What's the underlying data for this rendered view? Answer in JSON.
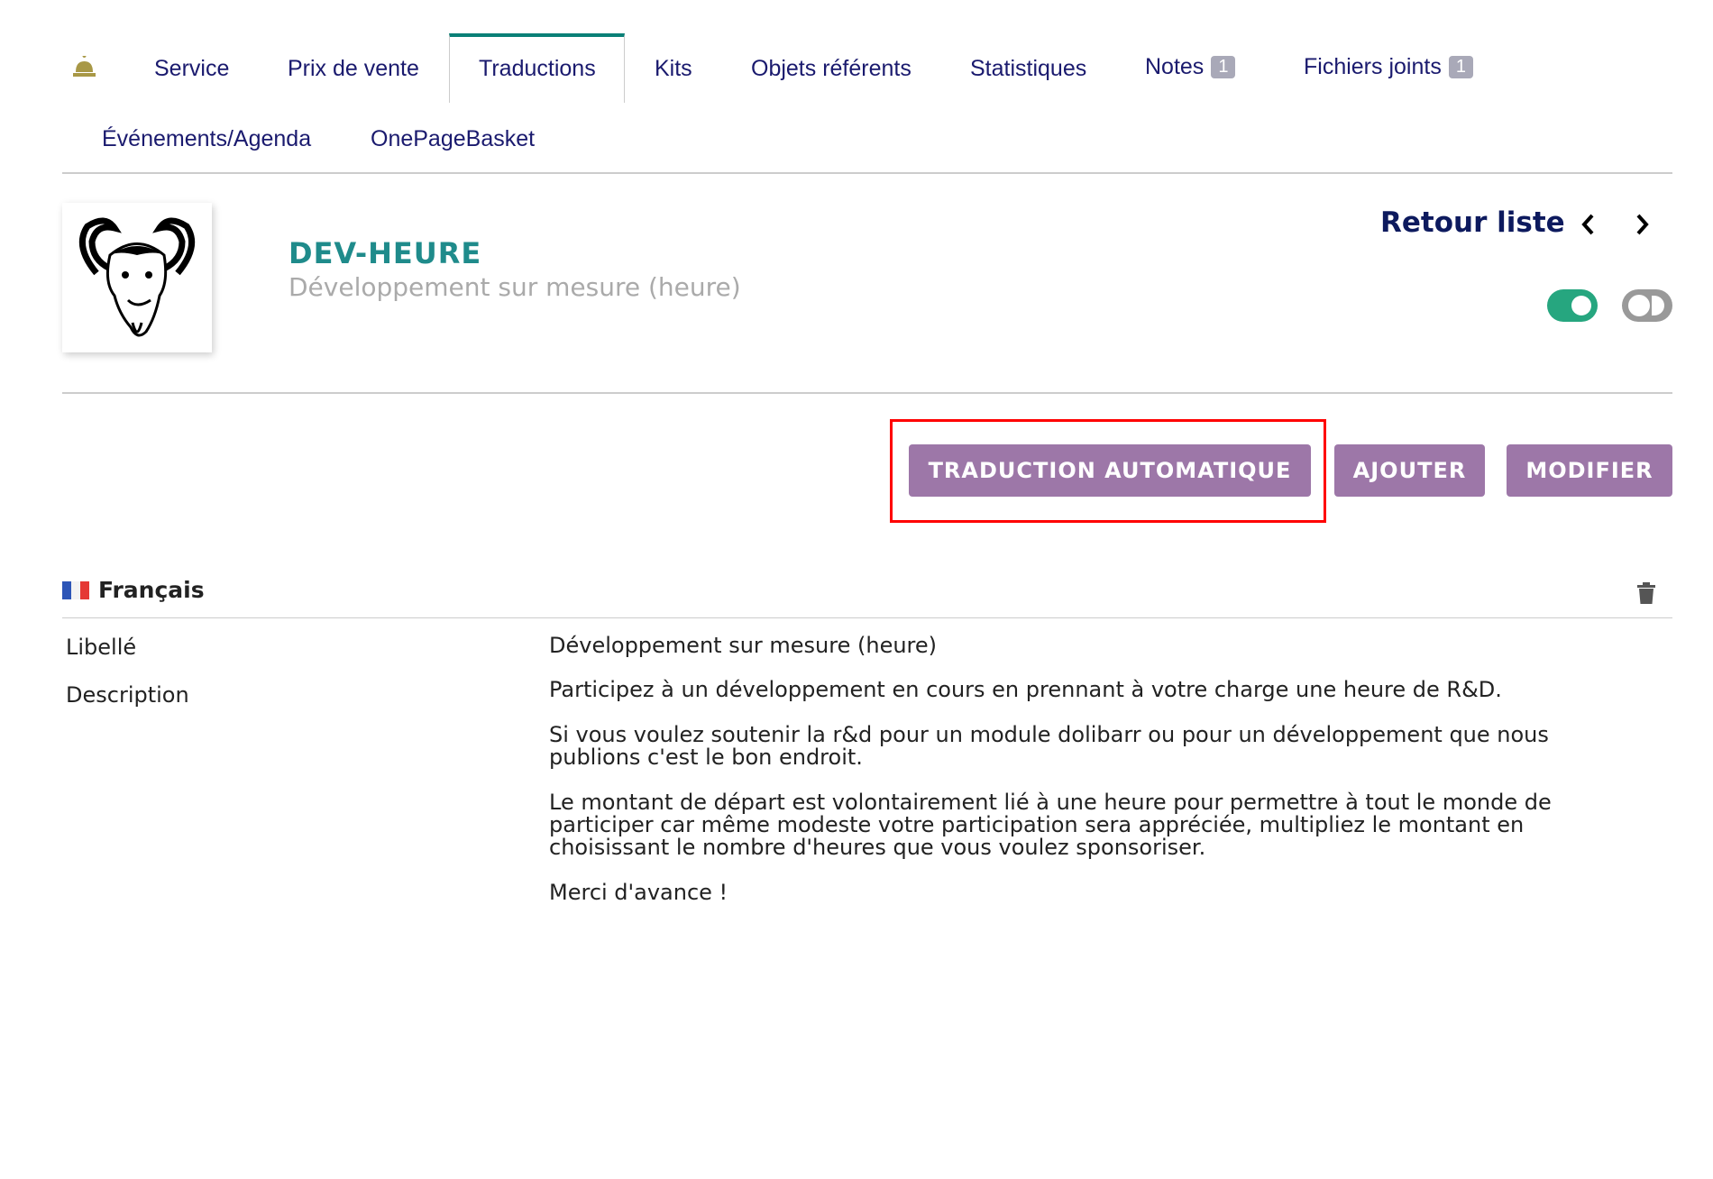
{
  "tabs": [
    {
      "label": "Service"
    },
    {
      "label": "Prix de vente"
    },
    {
      "label": "Traductions",
      "active": true
    },
    {
      "label": "Kits"
    },
    {
      "label": "Objets référents"
    },
    {
      "label": "Statistiques"
    },
    {
      "label": "Notes",
      "badge": "1"
    },
    {
      "label": "Fichiers joints",
      "badge": "1"
    },
    {
      "label": "Événements/Agenda"
    },
    {
      "label": "OnePageBasket"
    }
  ],
  "product": {
    "ref": "DEV-HEURE",
    "label": "Développement sur mesure (heure)"
  },
  "nav": {
    "back_list": "Retour liste"
  },
  "toggles": {
    "for_sale": true,
    "for_purchase": false
  },
  "buttons": {
    "auto_translate": "TRADUCTION AUTOMATIQUE",
    "add": "AJOUTER",
    "modify": "MODIFIER"
  },
  "translation": {
    "language": "Français",
    "label_field": "Libellé",
    "label_value": "Développement sur mesure (heure)",
    "description_field": "Description",
    "description_paragraphs": [
      "Participez à un développement en cours en prennant à votre charge une heure de R&D.",
      "Si vous voulez soutenir la r&d pour un module dolibarr ou pour un développement que nous publions c'est le bon endroit.",
      "Le montant de départ est volontairement lié à une heure pour permettre à tout le monde de participer car même modeste votre participation sera appréciée, multipliez le montant en choisissant le nombre d'heures que vous voulez sponsoriser.",
      "Merci d'avance !"
    ]
  },
  "colors": {
    "accent": "#0a8077",
    "button": "#9d77a8",
    "highlight": "#ff0000",
    "tab_text": "#1a1a6e"
  }
}
